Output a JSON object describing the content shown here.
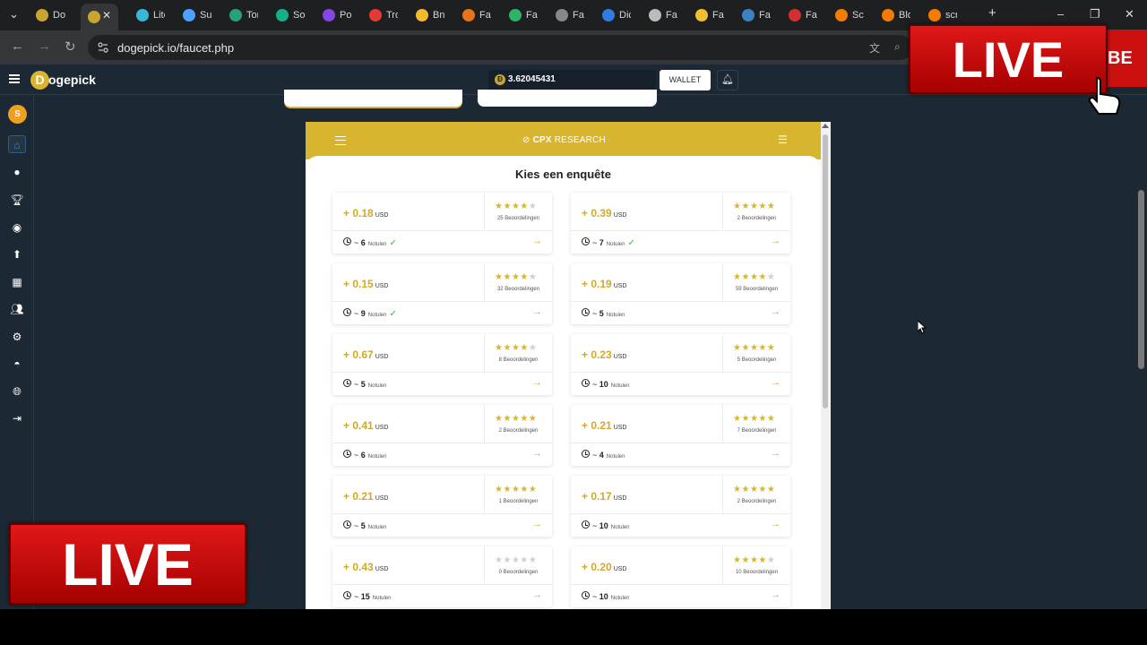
{
  "browser": {
    "tabs": [
      {
        "label": "Do",
        "color": "#c8a430"
      },
      {
        "label": "",
        "color": "#c8a430",
        "active": true
      },
      {
        "label": "Lite",
        "color": "#3ab7d8"
      },
      {
        "label": "Sui",
        "color": "#4da2ff"
      },
      {
        "label": "Tor",
        "color": "#26a17b"
      },
      {
        "label": "Sol",
        "color": "#14b08a"
      },
      {
        "label": "Pol",
        "color": "#8247e5"
      },
      {
        "label": "Tro",
        "color": "#e53935"
      },
      {
        "label": "Bnl",
        "color": "#f3ba2f"
      },
      {
        "label": "Fau",
        "color": "#e8731a"
      },
      {
        "label": "Fau",
        "color": "#2fb36a"
      },
      {
        "label": "Fau",
        "color": "#888888"
      },
      {
        "label": "Dic",
        "color": "#2f7de1"
      },
      {
        "label": "Fau",
        "color": "#bbbbbb"
      },
      {
        "label": "Fau",
        "color": "#f0c030"
      },
      {
        "label": "Fau",
        "color": "#3b82c4"
      },
      {
        "label": "Fau",
        "color": "#d32f2f"
      },
      {
        "label": "Scr",
        "color": "#f57c00"
      },
      {
        "label": "Blo",
        "color": "#f57c00"
      },
      {
        "label": "scr",
        "color": "#f57c00"
      }
    ],
    "url": "dogepick.io/faucet.php"
  },
  "site": {
    "logo": "ogepick",
    "logo_letter": "D",
    "balance": "3.62045431",
    "balance_coin": "Ð",
    "wallet_label": "WALLET",
    "avatar_letter": "S"
  },
  "cpx": {
    "logo_bold": "CPX",
    "logo_rest": " RESEARCH",
    "title": "Kies een enquête",
    "minutes_label": "Notulen",
    "surveys": [
      {
        "amount": "+ 0.18",
        "unit": "USD",
        "stars": 4,
        "reviews": "25 Beoordelingen",
        "time": "6",
        "done": true
      },
      {
        "amount": "+ 0.39",
        "unit": "USD",
        "stars": 5,
        "reviews": "2 Beoordelingen",
        "time": "7",
        "done": true
      },
      {
        "amount": "+ 0.15",
        "unit": "USD",
        "stars": 4,
        "reviews": "32 Beoordelingen",
        "time": "9",
        "done": true
      },
      {
        "amount": "+ 0.19",
        "unit": "USD",
        "stars": 4,
        "reviews": "59 Beoordelingen",
        "time": "5",
        "done": false
      },
      {
        "amount": "+ 0.67",
        "unit": "USD",
        "stars": 4,
        "reviews": "8 Beoordelingen",
        "time": "5",
        "done": false
      },
      {
        "amount": "+ 0.23",
        "unit": "USD",
        "stars": 5,
        "reviews": "5 Beoordelingen",
        "time": "10",
        "done": false
      },
      {
        "amount": "+ 0.41",
        "unit": "USD",
        "stars": 5,
        "reviews": "2 Beoordelingen",
        "time": "6",
        "done": false
      },
      {
        "amount": "+ 0.21",
        "unit": "USD",
        "stars": 5,
        "reviews": "7 Beoordelingen",
        "time": "4",
        "done": false
      },
      {
        "amount": "+ 0.21",
        "unit": "USD",
        "stars": 5,
        "reviews": "1 Beoordelingen",
        "time": "5",
        "done": false
      },
      {
        "amount": "+ 0.17",
        "unit": "USD",
        "stars": 5,
        "reviews": "2 Beoordelingen",
        "time": "10",
        "done": false
      },
      {
        "amount": "+ 0.43",
        "unit": "USD",
        "stars": 0,
        "reviews": "0 Beoordelingen",
        "time": "15",
        "done": false
      },
      {
        "amount": "+ 0.20",
        "unit": "USD",
        "stars": 4,
        "reviews": "10 Beoordelingen",
        "time": "10",
        "done": false
      }
    ]
  },
  "overlay": {
    "live_label": "LIVE",
    "yt_fragment": "BE"
  }
}
